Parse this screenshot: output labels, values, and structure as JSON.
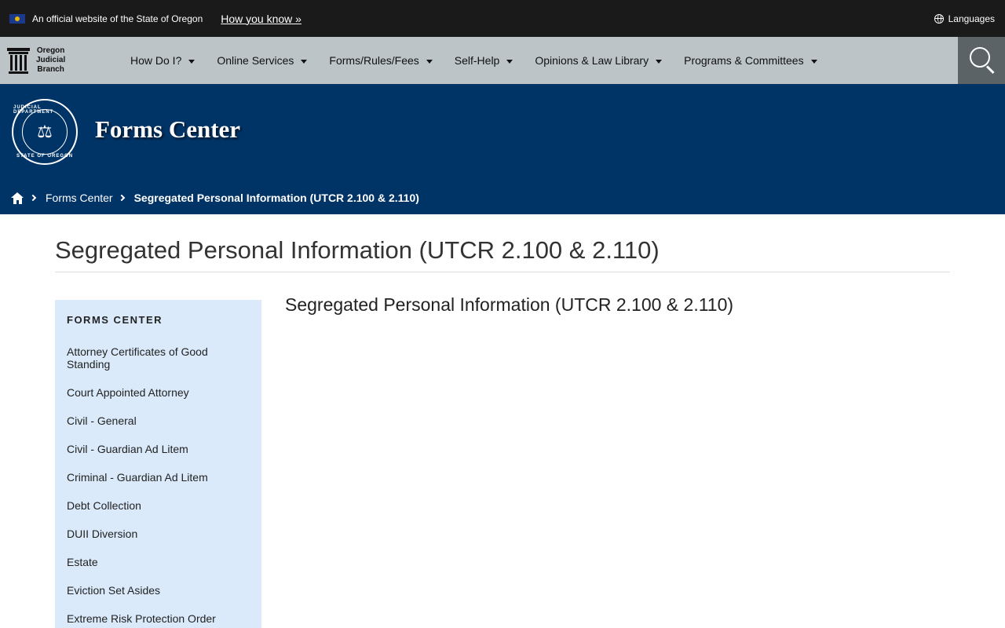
{
  "gov_banner": {
    "official_text": "An official website of the State of Oregon",
    "how_you_know": "How you know »",
    "languages": "Languages"
  },
  "brand": {
    "line1": "Oregon",
    "line2": "Judicial",
    "line3": "Branch"
  },
  "nav": {
    "items": [
      {
        "label": "How Do I?"
      },
      {
        "label": "Online Services"
      },
      {
        "label": "Forms/Rules/Fees"
      },
      {
        "label": "Self-Help"
      },
      {
        "label": "Opinions & Law Library"
      },
      {
        "label": "Programs & Committees"
      }
    ]
  },
  "hero": {
    "title": "Forms Center",
    "seal_top": "JUDICIAL DEPARTMENT",
    "seal_bottom": "STATE OF OREGON"
  },
  "breadcrumb": {
    "parent": "Forms Center",
    "current": "Segregated Personal Information (UTCR 2.100 & 2.110)"
  },
  "page": {
    "title": "Segregated Personal Information (UTCR 2.100 & 2.110)",
    "main_heading": "Segregated Personal Information (UTCR 2.100 & 2.110)"
  },
  "sidebar": {
    "heading": "FORMS CENTER",
    "items": [
      {
        "label": "Attorney Certificates of Good Standing"
      },
      {
        "label": "Court Appointed Attorney"
      },
      {
        "label": "Civil - General"
      },
      {
        "label": "Civil - Guardian Ad Litem"
      },
      {
        "label": "Criminal - Guardian Ad Litem"
      },
      {
        "label": "Debt Collection"
      },
      {
        "label": "DUII Diversion"
      },
      {
        "label": "Estate"
      },
      {
        "label": "Eviction Set Asides"
      },
      {
        "label": "Extreme Risk Protection Order"
      }
    ]
  }
}
